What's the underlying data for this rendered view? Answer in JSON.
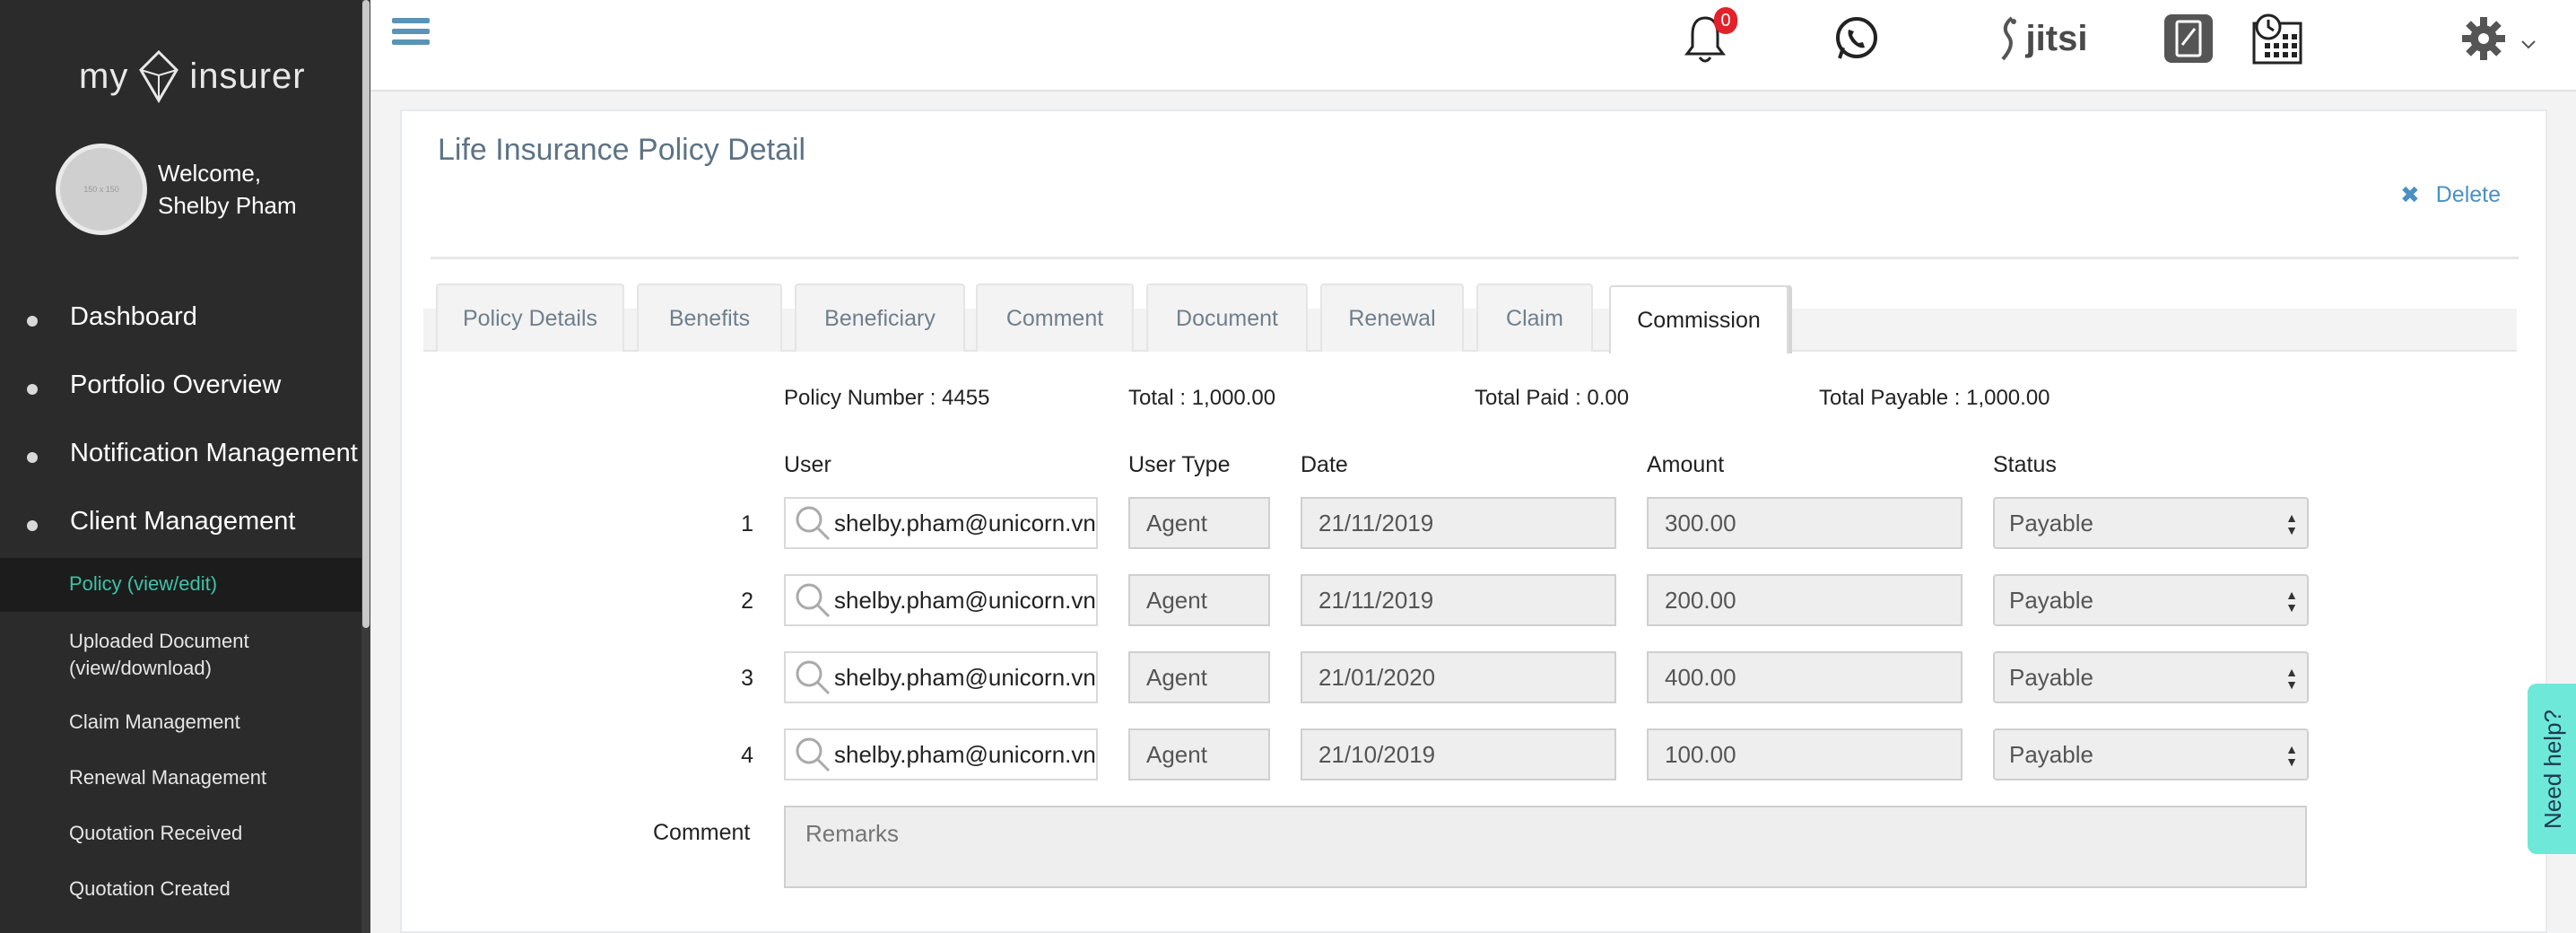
{
  "sidebar": {
    "logo_left": "my",
    "logo_right": "insurer",
    "avatar_placeholder": "150 x 150",
    "welcome_line1": "Welcome,",
    "welcome_line2": "Shelby Pham",
    "nav": [
      {
        "label": "Dashboard"
      },
      {
        "label": "Portfolio Overview"
      },
      {
        "label": "Notification Management"
      },
      {
        "label": "Client Management"
      }
    ],
    "sub": [
      {
        "label": "Policy (view/edit)",
        "active": true
      },
      {
        "label": "Uploaded Document (view/download)"
      },
      {
        "label": "Claim Management"
      },
      {
        "label": "Renewal Management"
      },
      {
        "label": "Quotation Received"
      },
      {
        "label": "Quotation Created"
      }
    ]
  },
  "topbar": {
    "notification_count": "0",
    "jitsi_label": "jitsi"
  },
  "page": {
    "title": "Life Insurance Policy Detail",
    "delete_label": "Delete"
  },
  "tabs": [
    {
      "label": "Policy Details"
    },
    {
      "label": "Benefits"
    },
    {
      "label": "Beneficiary"
    },
    {
      "label": "Comment"
    },
    {
      "label": "Document"
    },
    {
      "label": "Renewal"
    },
    {
      "label": "Claim"
    },
    {
      "label": "Commission",
      "active": true
    }
  ],
  "summary": {
    "policy_number": "Policy Number : 4455",
    "total": "Total : 1,000.00",
    "total_paid": "Total Paid : 0.00",
    "total_payable": "Total Payable : 1,000.00"
  },
  "columns": {
    "user": "User",
    "user_type": "User Type",
    "date": "Date",
    "amount": "Amount",
    "status": "Status"
  },
  "rows": [
    {
      "num": "1",
      "user": "shelby.pham@unicorn.vn",
      "user_type": "Agent",
      "date": "21/11/2019",
      "amount": "300.00",
      "status": "Payable"
    },
    {
      "num": "2",
      "user": "shelby.pham@unicorn.vn",
      "user_type": "Agent",
      "date": "21/11/2019",
      "amount": "200.00",
      "status": "Payable"
    },
    {
      "num": "3",
      "user": "shelby.pham@unicorn.vn",
      "user_type": "Agent",
      "date": "21/01/2020",
      "amount": "400.00",
      "status": "Payable"
    },
    {
      "num": "4",
      "user": "shelby.pham@unicorn.vn",
      "user_type": "Agent",
      "date": "21/10/2019",
      "amount": "100.00",
      "status": "Payable"
    }
  ],
  "comment": {
    "label": "Comment",
    "placeholder": "Remarks"
  },
  "help": {
    "label": "Need help?"
  },
  "colors": {
    "sidebar_bg": "#2b2b2c",
    "active_link": "#3fc2a6",
    "accent_blue": "#4a90c4",
    "help_tab": "#6ee8d9",
    "badge_red": "#e4212a"
  }
}
